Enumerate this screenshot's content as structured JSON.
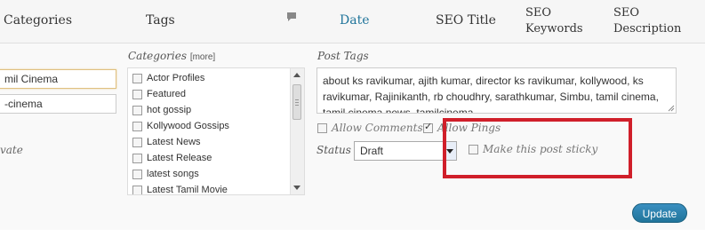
{
  "columns": {
    "categories": "Categories",
    "tags": "Tags",
    "date": "Date",
    "seo_title": "SEO Title",
    "seo_keywords": [
      "SEO",
      "Keywords"
    ],
    "seo_description": [
      "SEO",
      "Description"
    ]
  },
  "quick_edit": {
    "field_1_value": "mil Cinema",
    "field_2_value": "-cinema",
    "private_label": "vate"
  },
  "categories_panel": {
    "label": "Categories",
    "more": "[more]",
    "items": [
      {
        "label": "Actor Profiles",
        "checked": false
      },
      {
        "label": "Featured",
        "checked": false
      },
      {
        "label": "hot gossip",
        "checked": false
      },
      {
        "label": "Kollywood Gossips",
        "checked": false
      },
      {
        "label": "Latest News",
        "checked": false
      },
      {
        "label": "Latest Release",
        "checked": false
      },
      {
        "label": "latest songs",
        "checked": false
      },
      {
        "label": "Latest Tamil Movie",
        "checked": false
      }
    ]
  },
  "post_tags": {
    "label": "Post Tags",
    "value": "about ks ravikumar, ajith kumar, director ks ravikumar, kollywood, ks ravikumar, Rajinikanth, rb choudhry, sarathkumar, Simbu, tamil cinema, tamil cinema news, tamilcinema"
  },
  "options": {
    "allow_comments": {
      "label": "Allow Comments",
      "checked": false
    },
    "allow_pings": {
      "label": "Allow Pings",
      "checked": true
    },
    "sticky": {
      "label": "Make this post sticky",
      "checked": false
    }
  },
  "status": {
    "label": "Status",
    "value": "Draft"
  },
  "update_button": "Update",
  "colors": {
    "link": "#21759b",
    "highlight": "#d01f2a",
    "button": "#21759b"
  }
}
